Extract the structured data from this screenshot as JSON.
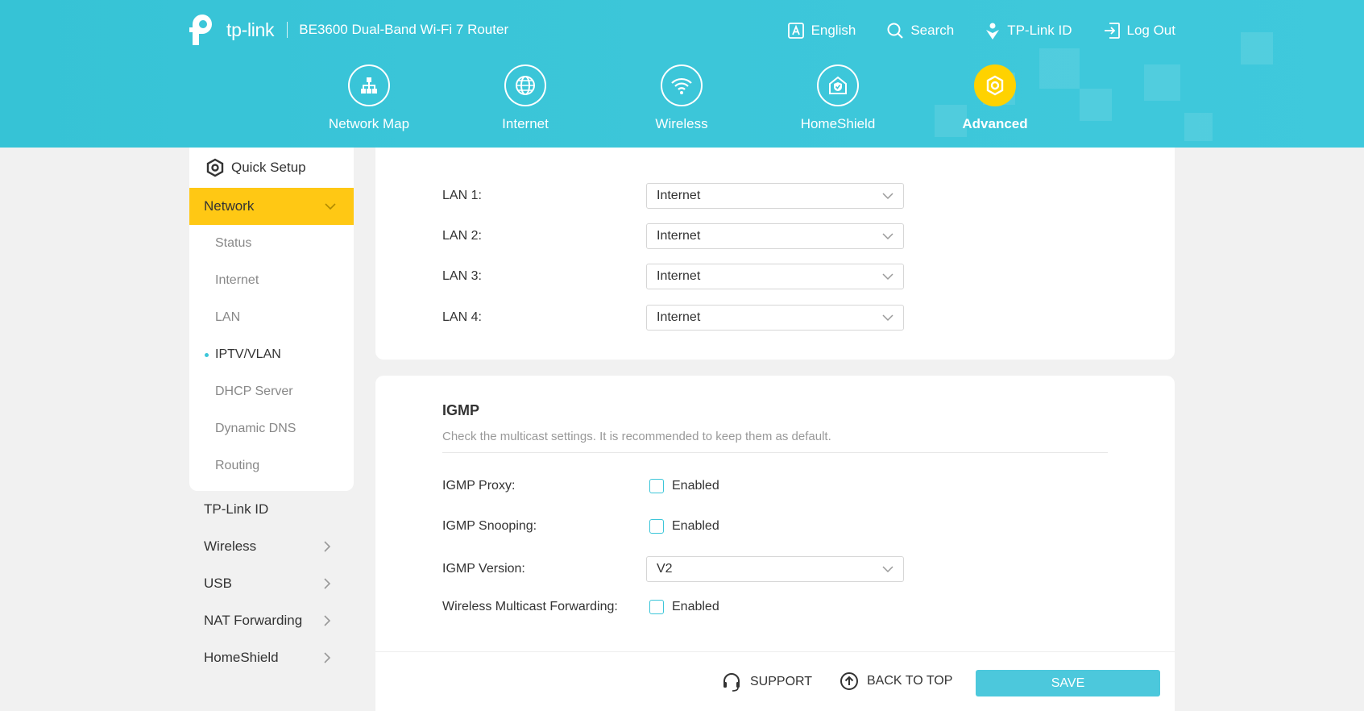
{
  "header": {
    "brand": "tp-link",
    "model": "BE3600 Dual-Band Wi-Fi 7 Router",
    "top_links": [
      {
        "label": "English",
        "icon": "language-icon"
      },
      {
        "label": "Search",
        "icon": "search-icon"
      },
      {
        "label": "TP-Link ID",
        "icon": "tplink-id-icon"
      },
      {
        "label": "Log Out",
        "icon": "logout-icon"
      }
    ],
    "main_nav": [
      {
        "label": "Network Map",
        "icon": "network-map-icon"
      },
      {
        "label": "Internet",
        "icon": "globe-icon"
      },
      {
        "label": "Wireless",
        "icon": "wifi-icon"
      },
      {
        "label": "HomeShield",
        "icon": "homeshield-icon"
      },
      {
        "label": "Advanced",
        "icon": "gear-icon",
        "active": true
      }
    ]
  },
  "sidebar": {
    "quick_setup": "Quick Setup",
    "network": "Network",
    "network_sub": [
      "Status",
      "Internet",
      "LAN",
      "IPTV/VLAN",
      "DHCP Server",
      "Dynamic DNS",
      "Routing"
    ],
    "active_sub": "IPTV/VLAN",
    "items": [
      "TP-Link ID",
      "Wireless",
      "USB",
      "NAT Forwarding",
      "HomeShield"
    ]
  },
  "lan": [
    {
      "label": "LAN 1:",
      "value": "Internet"
    },
    {
      "label": "LAN 2:",
      "value": "Internet"
    },
    {
      "label": "LAN 3:",
      "value": "Internet"
    },
    {
      "label": "LAN 4:",
      "value": "Internet"
    }
  ],
  "igmp": {
    "title": "IGMP",
    "description": "Check the multicast settings. It is recommended to keep them as default.",
    "proxy_label": "IGMP Proxy:",
    "snooping_label": "IGMP Snooping:",
    "version_label": "IGMP Version:",
    "version_value": "V2",
    "wmf_label": "Wireless Multicast Forwarding:",
    "enabled_text": "Enabled"
  },
  "footer": {
    "support": "SUPPORT",
    "back_to_top": "BACK TO TOP",
    "save": "SAVE"
  },
  "colors": {
    "header": "#3cc6d9",
    "accent_yellow": "#ffc814",
    "save_button": "#4cc8dc"
  }
}
